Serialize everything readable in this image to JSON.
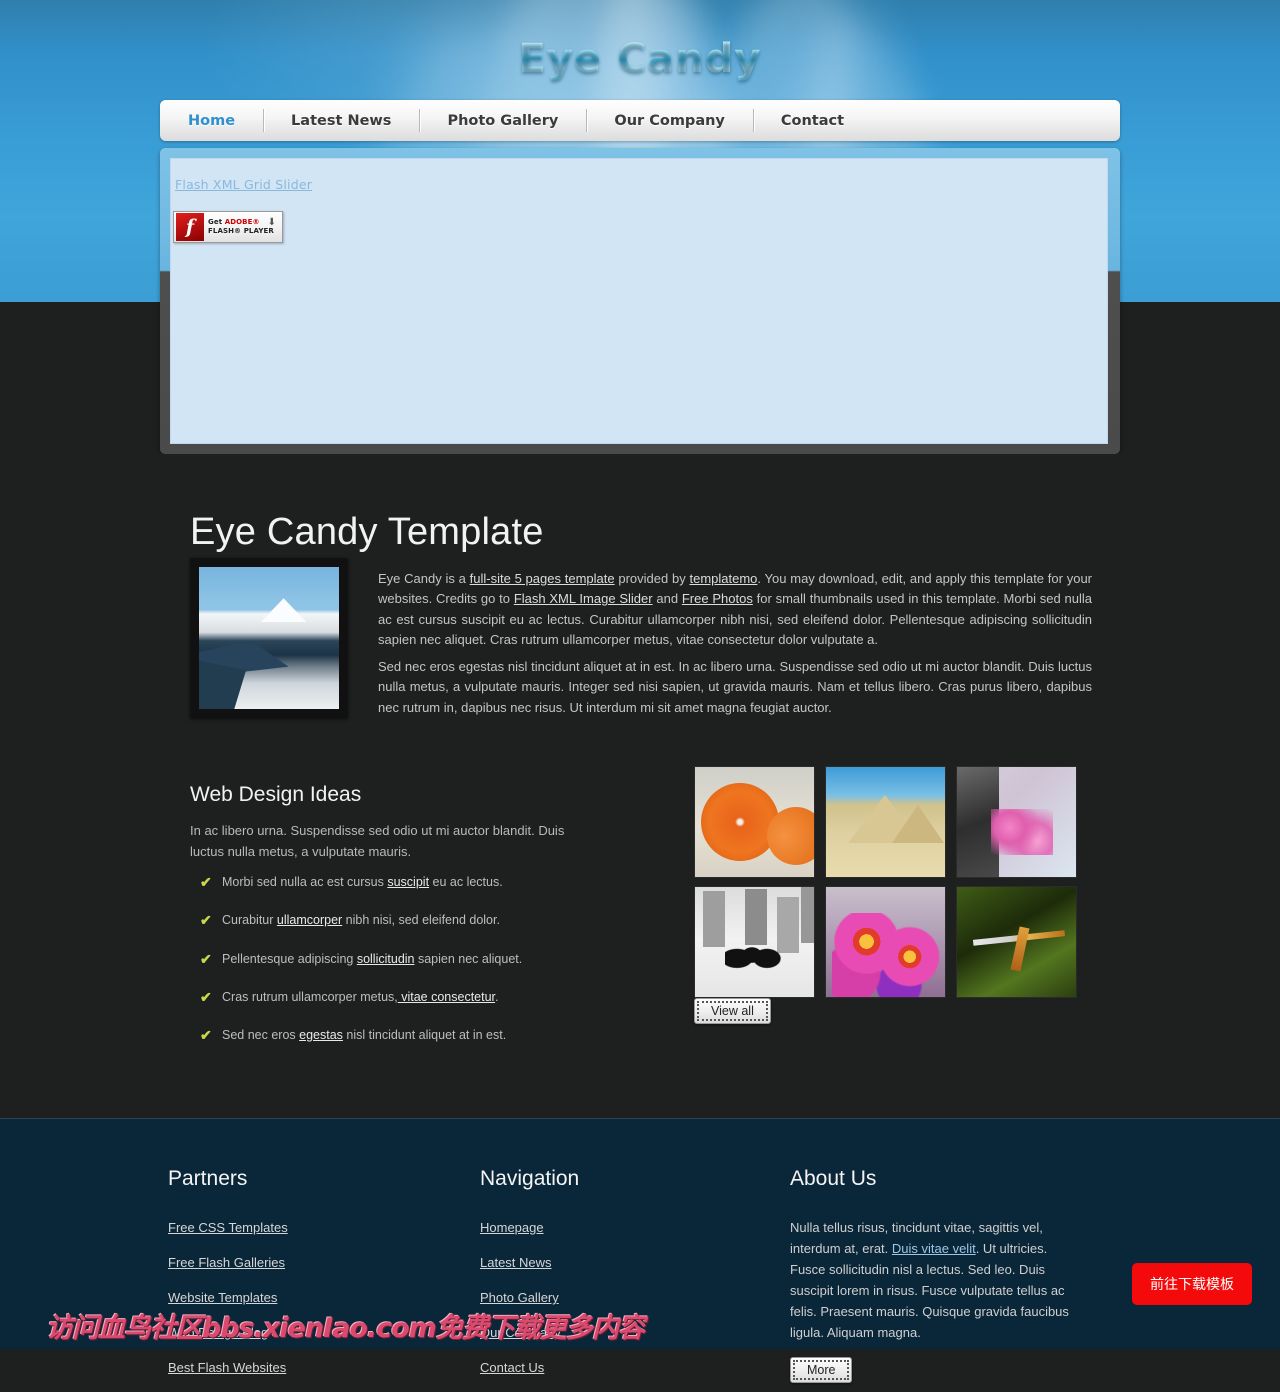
{
  "header": {
    "site_title": "Eye Candy",
    "nav": [
      {
        "label": "Home",
        "active": true
      },
      {
        "label": "Latest News",
        "active": false
      },
      {
        "label": "Photo Gallery",
        "active": false
      },
      {
        "label": "Our Company",
        "active": false
      },
      {
        "label": "Contact",
        "active": false
      }
    ]
  },
  "slider": {
    "link_label": "Flash XML Grid Slider",
    "flash_badge": {
      "line1_prefix": "Get ",
      "line1_brand": "ADOBE®",
      "line2": "FLASH® PLAYER",
      "arrow": "⬇"
    }
  },
  "main": {
    "page_title": "Eye Candy Template",
    "intro_paragraph_1": {
      "t1": "Eye Candy is a ",
      "a1": "full-site 5 pages template",
      "t2": " provided by ",
      "a2": "templatemo",
      "t3": ". You may download, edit, and apply this template for your websites. Credits go to ",
      "a3": "Flash XML Image Slider",
      "t4": " and ",
      "a4": "Free Photos",
      "t5": " for small thumbnails used in this template. Morbi sed nulla ac est cursus suscipit eu ac lectus. Curabitur ullamcorper nibh nisi, sed eleifend dolor. Pellentesque adipiscing sollicitudin sapien nec aliquet. Cras rutrum ullamcorper metus, vitae consectetur dolor vulputate a."
    },
    "intro_paragraph_2": "Sed nec eros egestas nisl tincidunt aliquet at in est. In ac libero urna. Suspendisse sed odio ut mi auctor blandit. Duis luctus nulla metus, a vulputate mauris. Integer sed nisi sapien, ut gravida mauris. Nam et tellus libero. Cras purus libero, dapibus nec rutrum in, dapibus nec risus. Ut interdum mi sit amet magna feugiat auctor.",
    "ideas_title": "Web Design Ideas",
    "ideas_intro": "In ac libero urna. Suspendisse sed odio ut mi auctor blandit. Duis luctus nulla metus, a vulputate mauris.",
    "ideas_items": [
      {
        "before": "Morbi sed nulla ac est cursus ",
        "link": "suscipit",
        "after": " eu ac lectus."
      },
      {
        "before": "Curabitur ",
        "link": "ullamcorper",
        "after": " nibh nisi, sed eleifend dolor."
      },
      {
        "before": "Pellentesque adipiscing ",
        "link": "sollicitudin",
        "after": " sapien nec aliquet."
      },
      {
        "before": "Cras rutrum ullamcorper metus,",
        "link": " vitae consectetur",
        "after": "."
      },
      {
        "before": "Sed nec eros ",
        "link": "egestas",
        "after": " nisl tincidunt aliquet at in est."
      }
    ],
    "tick_glyph": "✔",
    "thumbnails": [
      {
        "name": "orange-fruit-thumbnail"
      },
      {
        "name": "pyramids-thumbnail"
      },
      {
        "name": "pink-blossom-thumbnail"
      },
      {
        "name": "city-silhouette-thumbnail"
      },
      {
        "name": "pink-flowers-thumbnail"
      },
      {
        "name": "dragonfly-thumbnail"
      }
    ],
    "view_all_label": "View all"
  },
  "footer": {
    "partners": {
      "title": "Partners",
      "links": [
        "Free CSS Templates",
        "Free Flash Galleries",
        "Website Templates",
        "Web Design Blog",
        "Best Flash Websites"
      ]
    },
    "navigation": {
      "title": "Navigation",
      "links": [
        "Homepage",
        "Latest News",
        "Photo Gallery",
        "Our Company",
        "Contact Us"
      ]
    },
    "about": {
      "title": "About Us",
      "text_1": "Nulla tellus risus, tincidunt vitae, sagittis vel, interdum at, erat. ",
      "link": "Duis vitae velit",
      "text_2": ". Ut ultricies. Fusce sollicitudin nisl a lectus. Sed leo. Duis suscipit lorem in risus. Fusce vulputate tellus ac felis. Praesent mauris. Quisque gravida faucibus ligula. Aliquam magna.",
      "more_label": "More"
    }
  },
  "overlays": {
    "download_cta_label": "前往下载模板",
    "watermark_text": "访问血鸟社区bbs.xienIao.com免费下载更多内容"
  },
  "colors": {
    "header_blue": "#3a9ed6",
    "accent_link_blue": "#2f8fd0",
    "body_dark": "#1e2020",
    "footer_navy": "#0a2639",
    "cta_red": "#f40a0a",
    "tick_green": "#c9d84a",
    "watermark_pink": "#d94a6e"
  }
}
